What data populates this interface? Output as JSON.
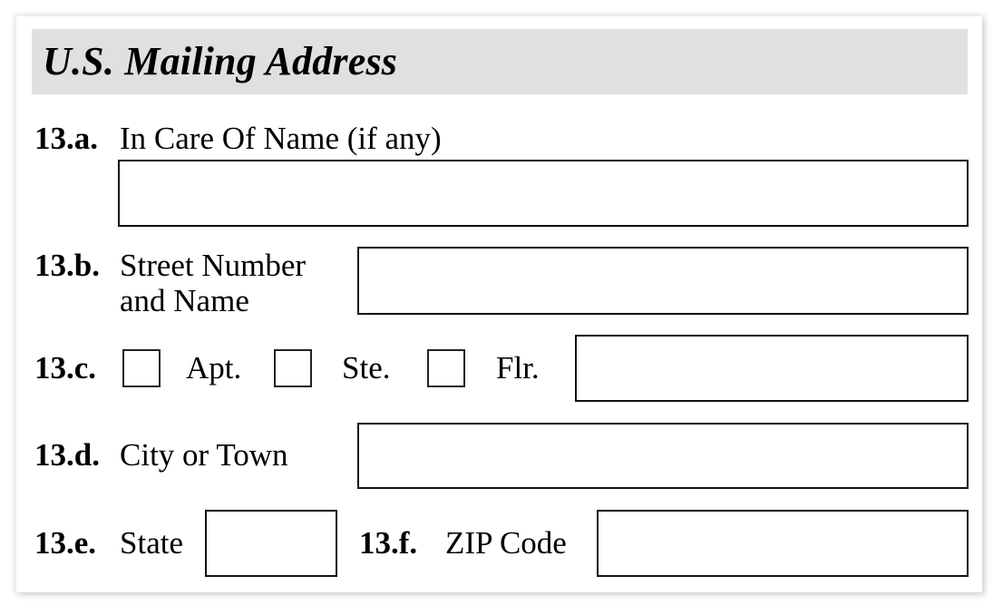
{
  "section": {
    "title": "U.S. Mailing Address"
  },
  "fields": {
    "care_of": {
      "number": "13.a.",
      "label": "In Care Of Name (if any)",
      "value": ""
    },
    "street": {
      "number": "13.b.",
      "label_line1": "Street Number",
      "label_line2": "and Name",
      "value": ""
    },
    "unit": {
      "number": "13.c.",
      "options": [
        {
          "label": "Apt.",
          "checked": false
        },
        {
          "label": "Ste.",
          "checked": false
        },
        {
          "label": "Flr.",
          "checked": false
        }
      ],
      "value": ""
    },
    "city": {
      "number": "13.d.",
      "label": "City or Town",
      "value": ""
    },
    "state": {
      "number": "13.e.",
      "label": "State",
      "value": ""
    },
    "zip": {
      "number": "13.f.",
      "label": "ZIP Code",
      "value": ""
    }
  }
}
